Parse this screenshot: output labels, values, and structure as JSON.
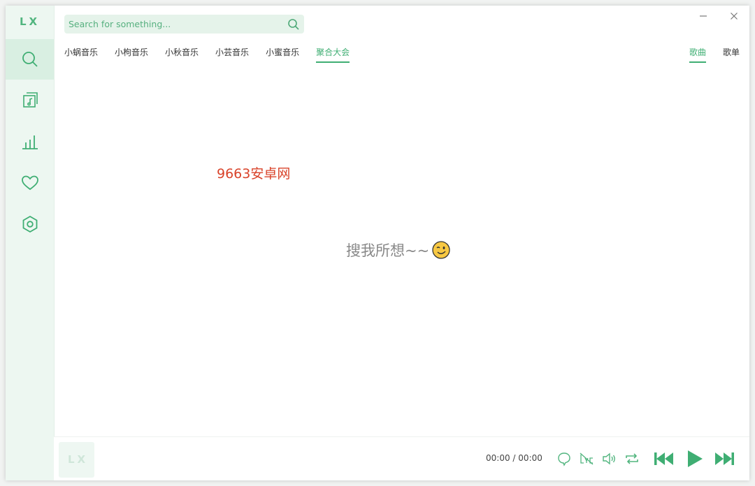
{
  "app": {
    "logo": "LX"
  },
  "search": {
    "placeholder": "Search for something...",
    "value": ""
  },
  "sources": [
    {
      "label": "小蜗音乐",
      "active": false
    },
    {
      "label": "小枸音乐",
      "active": false
    },
    {
      "label": "小秋音乐",
      "active": false
    },
    {
      "label": "小芸音乐",
      "active": false
    },
    {
      "label": "小蜜音乐",
      "active": false
    },
    {
      "label": "聚合大会",
      "active": true
    }
  ],
  "search_types": [
    {
      "label": "歌曲",
      "active": true
    },
    {
      "label": "歌单",
      "active": false
    }
  ],
  "sidebar": {
    "items": [
      {
        "name": "search",
        "icon": "search-icon",
        "active": true
      },
      {
        "name": "song-list",
        "icon": "music-list-icon",
        "active": false
      },
      {
        "name": "leaderboard",
        "icon": "chart-icon",
        "active": false
      },
      {
        "name": "favorites",
        "icon": "heart-icon",
        "active": false
      },
      {
        "name": "settings",
        "icon": "settings-icon",
        "active": false
      }
    ]
  },
  "main": {
    "watermark": "9663安卓网",
    "empty_text": "搜我所想~~"
  },
  "player": {
    "cover_text": "LX",
    "current_time": "00:00",
    "separator": "/",
    "total_time": "00:00"
  },
  "colors": {
    "accent": "#3fae73",
    "sidebar_bg": "#edf7f1",
    "search_bg": "#e5f3ea",
    "watermark": "#d9432a"
  }
}
